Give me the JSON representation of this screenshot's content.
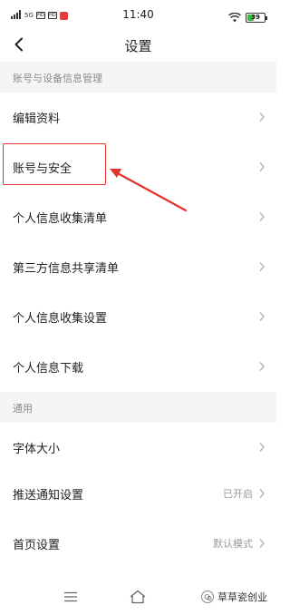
{
  "status_bar": {
    "time": "11:40",
    "left_indicators": [
      "5G",
      "HD",
      "HD"
    ],
    "battery_text": "39",
    "battery_level": 0.39,
    "battery_color": "#3dbb3d",
    "icons": [
      "signal-icon",
      "hd-icon",
      "wifi-icon",
      "battery-icon"
    ]
  },
  "nav": {
    "title": "设置",
    "back_icon": "chevron-left-icon"
  },
  "sections": [
    {
      "header": "账号与设备信息管理",
      "items": [
        {
          "label": "编辑资料",
          "value": ""
        },
        {
          "label": "账号与安全",
          "value": ""
        },
        {
          "label": "个人信息收集清单",
          "value": ""
        },
        {
          "label": "第三方信息共享清单",
          "value": ""
        },
        {
          "label": "个人信息收集设置",
          "value": ""
        },
        {
          "label": "个人信息下载",
          "value": ""
        }
      ]
    },
    {
      "header": "通用",
      "items": [
        {
          "label": "字体大小",
          "value": ""
        },
        {
          "label": "推送通知设置",
          "value": "已开启"
        },
        {
          "label": "首页设置",
          "value": "默认模式"
        }
      ]
    }
  ],
  "annotation": {
    "highlight_color": "#e5322d",
    "highlighted_item": "账号与安全"
  },
  "bottom_bar": {
    "buttons": [
      "menu-icon",
      "home-icon",
      "back-icon"
    ]
  },
  "watermark": {
    "text": "草草瓷创业"
  }
}
